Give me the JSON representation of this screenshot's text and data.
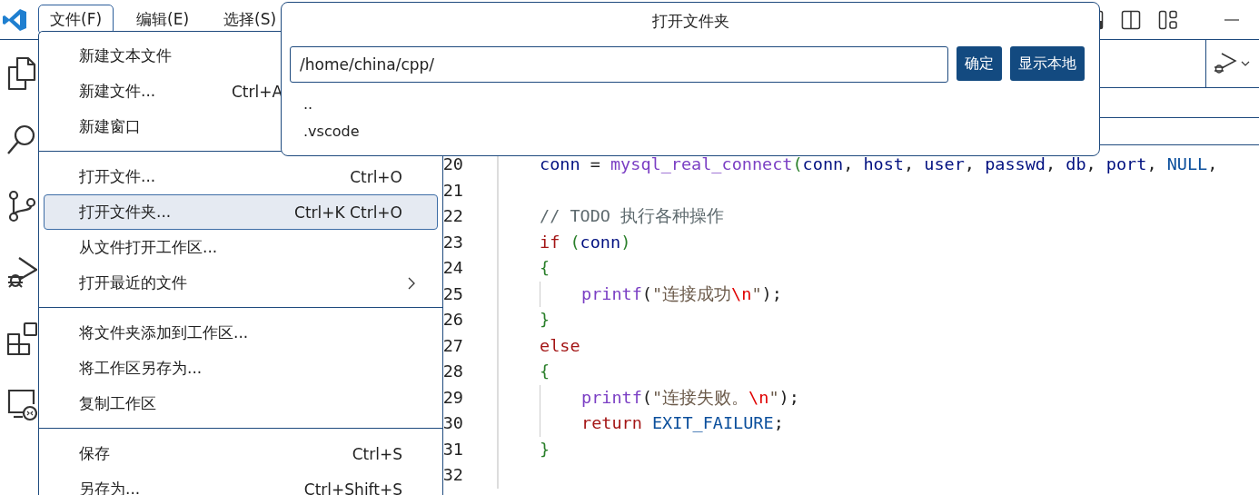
{
  "menubar": [
    {
      "label": "文件(F)",
      "selected": true
    },
    {
      "label": "编辑(E)",
      "selected": false
    },
    {
      "label": "选择(S)",
      "selected": false
    }
  ],
  "file_menu": {
    "groups": [
      [
        {
          "label": "新建文本文件",
          "selected": false
        },
        {
          "label": "新建文件...",
          "shortcut": "Ctrl+A",
          "selected": false
        },
        {
          "label": "新建窗口",
          "selected": false
        }
      ],
      [
        {
          "label": "打开文件...",
          "shortcut": "Ctrl+O",
          "selected": false
        },
        {
          "label": "打开文件夹...",
          "shortcut": "Ctrl+K Ctrl+O",
          "selected": true
        },
        {
          "label": "从文件打开工作区...",
          "selected": false
        },
        {
          "label": "打开最近的文件",
          "submenu": true,
          "selected": false
        }
      ],
      [
        {
          "label": "将文件夹添加到工作区...",
          "selected": false
        },
        {
          "label": "将工作区另存为...",
          "selected": false
        },
        {
          "label": "复制工作区",
          "selected": false
        }
      ],
      [
        {
          "label": "保存",
          "shortcut": "Ctrl+S",
          "selected": false
        },
        {
          "label": "另存为...",
          "shortcut": "Ctrl+Shift+S",
          "selected": false
        }
      ]
    ]
  },
  "dialog": {
    "title": "打开文件夹",
    "path": "/home/china/cpp/",
    "buttons": [
      "确定",
      "显示本地"
    ],
    "entries": [
      "..",
      ".vscode"
    ]
  },
  "editor": {
    "lines": [
      {
        "number": "20",
        "block": false,
        "tokens": [
          {
            "kind": "var",
            "text": "conn"
          },
          {
            "kind": "plain",
            "text": " = "
          },
          {
            "kind": "func",
            "text": "mysql_real_connect"
          },
          {
            "kind": "paren",
            "text": "("
          },
          {
            "kind": "var",
            "text": "conn"
          },
          {
            "kind": "plain",
            "text": ", "
          },
          {
            "kind": "var",
            "text": "host"
          },
          {
            "kind": "plain",
            "text": ", "
          },
          {
            "kind": "var",
            "text": "user"
          },
          {
            "kind": "plain",
            "text": ", "
          },
          {
            "kind": "var",
            "text": "passwd"
          },
          {
            "kind": "plain",
            "text": ", "
          },
          {
            "kind": "var",
            "text": "db"
          },
          {
            "kind": "plain",
            "text": ", "
          },
          {
            "kind": "var",
            "text": "port"
          },
          {
            "kind": "plain",
            "text": ", "
          },
          {
            "kind": "const",
            "text": "NULL"
          },
          {
            "kind": "plain",
            "text": ","
          }
        ]
      },
      {
        "number": "21",
        "block": false
      },
      {
        "number": "22",
        "block": false,
        "tokens": [
          {
            "kind": "comment",
            "text": "// TODO 执行各种操作"
          }
        ]
      },
      {
        "number": "23",
        "block": false,
        "tokens": [
          {
            "kind": "keyword",
            "text": "if"
          },
          {
            "kind": "paren",
            "text": " ("
          },
          {
            "kind": "var",
            "text": "conn"
          },
          {
            "kind": "paren",
            "text": ")"
          }
        ]
      },
      {
        "number": "24",
        "block": false,
        "tokens": [
          {
            "kind": "brace",
            "text": "{"
          }
        ]
      },
      {
        "number": "25",
        "block": true,
        "tokens": [
          {
            "kind": "func",
            "text": "printf"
          },
          {
            "kind": "plain",
            "text": "("
          },
          {
            "kind": "string",
            "text": "\"连接成功"
          },
          {
            "kind": "escape",
            "text": "\\n"
          },
          {
            "kind": "string",
            "text": "\""
          },
          {
            "kind": "plain",
            "text": ");"
          }
        ]
      },
      {
        "number": "26",
        "block": false,
        "tokens": [
          {
            "kind": "brace",
            "text": "}"
          }
        ]
      },
      {
        "number": "27",
        "block": false,
        "tokens": [
          {
            "kind": "keyword",
            "text": "else"
          }
        ]
      },
      {
        "number": "28",
        "block": false,
        "tokens": [
          {
            "kind": "brace",
            "text": "{"
          }
        ]
      },
      {
        "number": "29",
        "block": true,
        "tokens": [
          {
            "kind": "func",
            "text": "printf"
          },
          {
            "kind": "plain",
            "text": "("
          },
          {
            "kind": "string",
            "text": "\"连接失败。"
          },
          {
            "kind": "escape",
            "text": "\\n"
          },
          {
            "kind": "string",
            "text": "\""
          },
          {
            "kind": "plain",
            "text": ");"
          }
        ]
      },
      {
        "number": "30",
        "block": true,
        "tokens": [
          {
            "kind": "keyword",
            "text": "return"
          },
          {
            "kind": "const",
            "text": " EXIT_FAILURE"
          },
          {
            "kind": "plain",
            "text": ";"
          }
        ]
      },
      {
        "number": "31",
        "block": false,
        "tokens": [
          {
            "kind": "brace",
            "text": "}"
          }
        ]
      },
      {
        "number": "32",
        "block": false
      }
    ]
  }
}
